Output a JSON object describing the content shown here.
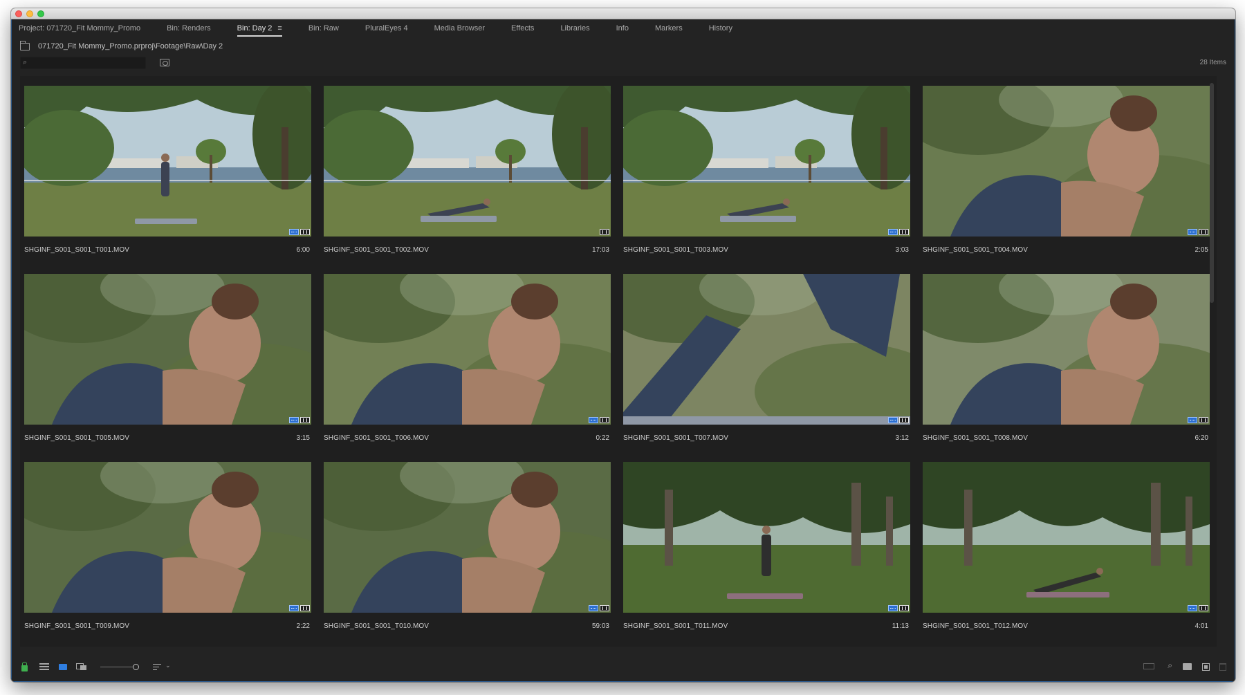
{
  "tabs": [
    {
      "label": "Project: 071720_Fit Mommy_Promo",
      "active": false
    },
    {
      "label": "Bin: Renders",
      "active": false
    },
    {
      "label": "Bin: Day 2",
      "active": true
    },
    {
      "label": "Bin: Raw",
      "active": false
    },
    {
      "label": "PluralEyes 4",
      "active": false
    },
    {
      "label": "Media Browser",
      "active": false
    },
    {
      "label": "Effects",
      "active": false
    },
    {
      "label": "Libraries",
      "active": false
    },
    {
      "label": "Info",
      "active": false
    },
    {
      "label": "Markers",
      "active": false
    },
    {
      "label": "History",
      "active": false
    }
  ],
  "active_tab_menu_glyph": "≡",
  "path": "071720_Fit Mommy_Promo.prproj\\Footage\\Raw\\Day 2",
  "search": {
    "value": "",
    "placeholder": ""
  },
  "items_count": "28 Items",
  "clips": [
    {
      "name": "SHGINF_S001_S001_T001.MOV",
      "duration": "6:00",
      "scene": "wide-stand",
      "badges": [
        "video",
        "audio"
      ]
    },
    {
      "name": "SHGINF_S001_S001_T002.MOV",
      "duration": "17:03",
      "scene": "wide-plank",
      "badges": [
        "audio"
      ]
    },
    {
      "name": "SHGINF_S001_S001_T003.MOV",
      "duration": "3:03",
      "scene": "wide-plank",
      "badges": [
        "video",
        "audio"
      ]
    },
    {
      "name": "SHGINF_S001_S001_T004.MOV",
      "duration": "2:05",
      "scene": "close-crawl",
      "badges": [
        "video",
        "audio"
      ]
    },
    {
      "name": "SHGINF_S001_S001_T005.MOV",
      "duration": "3:15",
      "scene": "close-face",
      "badges": [
        "video",
        "audio"
      ]
    },
    {
      "name": "SHGINF_S001_S001_T006.MOV",
      "duration": "0:22",
      "scene": "close-lunge",
      "badges": [
        "video",
        "audio"
      ]
    },
    {
      "name": "SHGINF_S001_S001_T007.MOV",
      "duration": "3:12",
      "scene": "close-legs",
      "badges": [
        "video",
        "audio"
      ]
    },
    {
      "name": "SHGINF_S001_S001_T008.MOV",
      "duration": "6:20",
      "scene": "close-bun",
      "badges": [
        "video",
        "audio"
      ]
    },
    {
      "name": "SHGINF_S001_S001_T009.MOV",
      "duration": "2:22",
      "scene": "close-face",
      "badges": [
        "video",
        "audio"
      ]
    },
    {
      "name": "SHGINF_S001_S001_T010.MOV",
      "duration": "59:03",
      "scene": "close-face",
      "badges": [
        "video",
        "audio"
      ]
    },
    {
      "name": "SHGINF_S001_S001_T011.MOV",
      "duration": "11:13",
      "scene": "park-stand",
      "badges": [
        "video",
        "audio"
      ]
    },
    {
      "name": "SHGINF_S001_S001_T012.MOV",
      "duration": "4:01",
      "scene": "park-plank",
      "badges": [
        "video",
        "audio"
      ]
    }
  ],
  "icons": {
    "bin": "bin-icon",
    "search": "search-icon",
    "new_bin": "new-bin-icon",
    "lock": "lock-icon",
    "list_view": "list-view-icon",
    "icon_view": "icon-view-icon",
    "freeform_view": "freeform-view-icon",
    "sort": "sort-icon",
    "automate": "automate-to-sequence-icon",
    "find": "find-icon",
    "new_folder": "new-bin-folder-icon",
    "new_item": "new-item-icon",
    "clear": "trash-icon"
  },
  "colors": {
    "accent": "#2f7ee0",
    "panel": "#232323",
    "lock": "#3fb04f"
  }
}
